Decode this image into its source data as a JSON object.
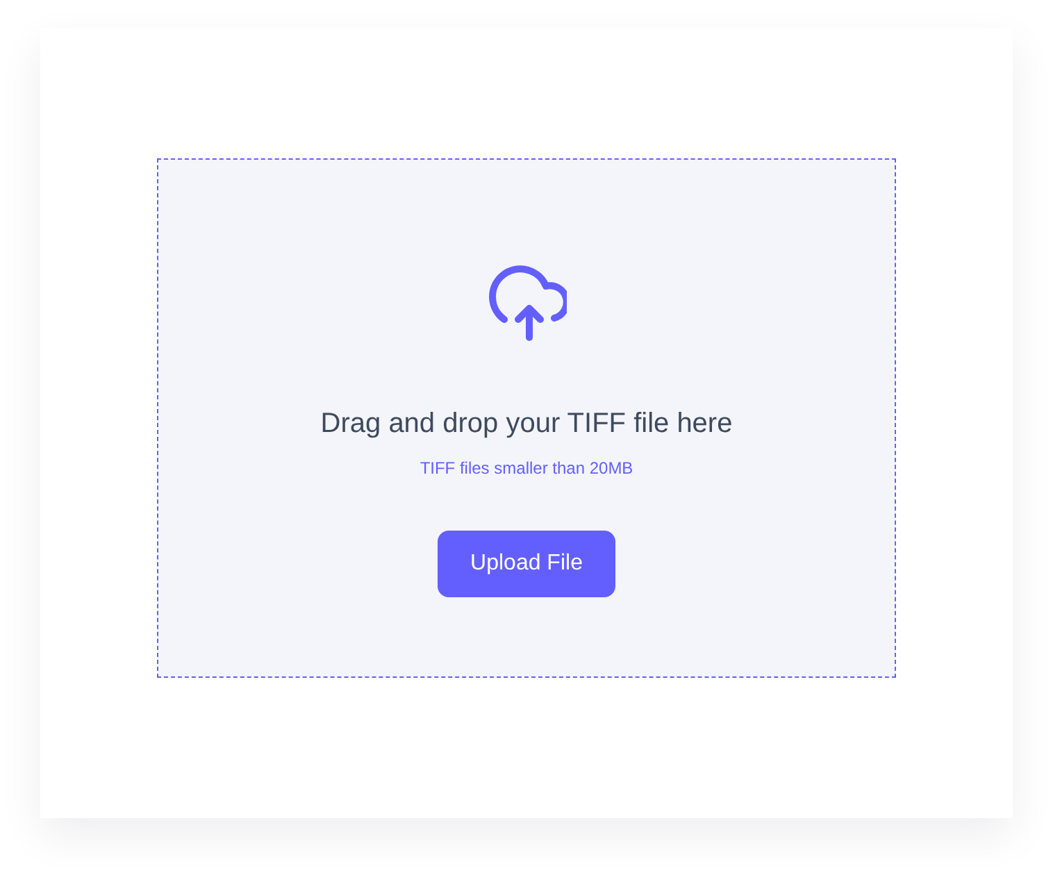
{
  "dropzone": {
    "title": "Drag and drop your TIFF file here",
    "hint": "TIFF files smaller than 20MB",
    "button": {
      "label": "Upload File"
    }
  }
}
